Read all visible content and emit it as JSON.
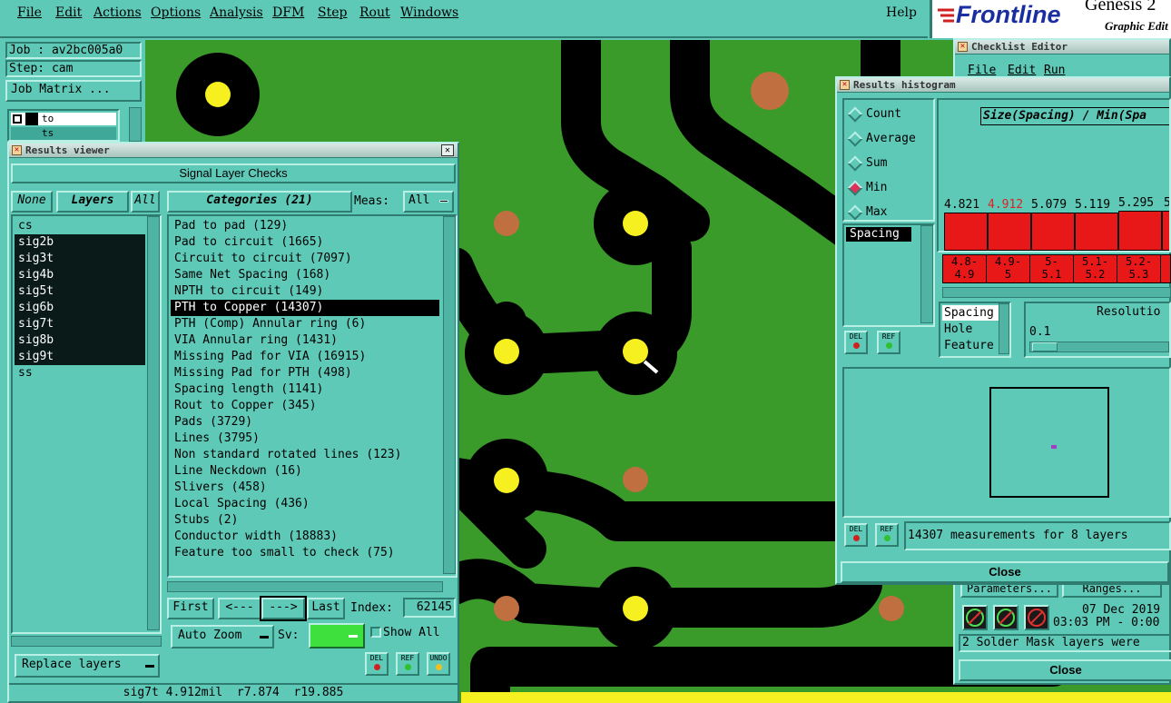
{
  "menu": {
    "items": [
      "File",
      "Edit",
      "Actions",
      "Options",
      "Analysis",
      "DFM",
      "Step",
      "Rout",
      "Windows"
    ],
    "help": "Help"
  },
  "logo": {
    "brand": "Frontline",
    "product": "Genesis 2",
    "subtitle": "Graphic Edit"
  },
  "job_panel": {
    "job": "Job : av2bc005a0",
    "step": "Step: cam",
    "job_matrix": "Job Matrix ...",
    "layer_row1": "to",
    "layer_row2": "ts"
  },
  "results_viewer": {
    "title": "Results viewer",
    "header": "Signal Layer Checks",
    "none_btn": "None",
    "layers_btn": "Layers",
    "all_btn": "All",
    "categories_btn": "Categories (21)",
    "meas_label": "Meas:",
    "meas_value": "All",
    "layers": [
      "cs",
      "sig2b",
      "sig3t",
      "sig4b",
      "sig5t",
      "sig6b",
      "sig7t",
      "sig8b",
      "sig9t",
      "ss"
    ],
    "categories": [
      "Pad to pad (129)",
      "Pad to circuit (1665)",
      "Circuit to circuit (7097)",
      "Same Net Spacing (168)",
      "NPTH to circuit (149)",
      "PTH to Copper (14307)",
      "PTH (Comp) Annular ring (6)",
      "VIA Annular ring (1431)",
      "Missing Pad for VIA (16915)",
      "Missing Pad for PTH (498)",
      "Spacing length (1141)",
      "Rout to Copper (345)",
      "Pads (3729)",
      "Lines (3795)",
      "Non standard rotated lines (123)",
      "Line Neckdown (16)",
      "Slivers (458)",
      "Local Spacing (436)",
      "Stubs (2)",
      "Conductor width (18883)",
      "Feature too small to check (75)"
    ],
    "first_btn": "First",
    "prev_btn": "<---",
    "next_btn": "--->",
    "last_btn": "Last",
    "index_label": "Index:",
    "index_value": "62145",
    "auto_zoom": "Auto Zoom",
    "sv_label": "Sv:",
    "show_all": "Show All",
    "replace_layers": "Replace layers",
    "del": "DEL",
    "ref": "REF",
    "undo": "UNDO",
    "status": "sig7t 4.912mil  r7.874  r19.885"
  },
  "histogram": {
    "title": "Results histogram",
    "modes": [
      "Count",
      "Average",
      "Sum",
      "Min",
      "Max"
    ],
    "selected_mode": "Min",
    "list_item": "Spacing",
    "header": "Size(Spacing) / Min(Spa",
    "bins": [
      "4.8-4.9",
      "4.9-5",
      "5-5.1",
      "5.1-5.2",
      "5.2-5.3"
    ],
    "bin_labels_top": [
      "4.8-",
      "4.9-",
      "5-",
      "5.1-",
      "5.2-"
    ],
    "bin_labels_bottom": [
      "4.9",
      "5",
      "5.1",
      "5.2",
      "5.3"
    ],
    "values": [
      "4.821",
      "4.912",
      "5.079",
      "5.119",
      "5.295",
      "5"
    ],
    "highlight_value": "4.912",
    "types": [
      "Spacing",
      "Hole",
      "Feature"
    ],
    "resolution_label": "Resolutio",
    "resolution_value": "0.1",
    "summary": "14307 measurements for 8 layers",
    "close": "Close",
    "del": "DEL",
    "ref": "REF"
  },
  "checklist": {
    "title": "Checklist Editor",
    "menu": [
      "File",
      "Edit",
      "Run"
    ],
    "parameters": "Parameters...",
    "ranges": "Ranges...",
    "date": "07 Dec 2019",
    "time": "03:03 PM - 0:00",
    "message": "2 Solder Mask layers were",
    "close": "Close"
  }
}
